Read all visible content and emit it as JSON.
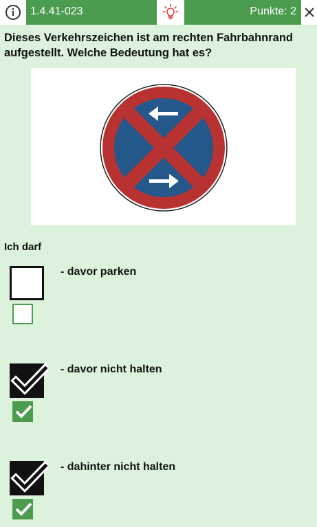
{
  "header": {
    "question_code": "1.4.41-023",
    "score_label": "Punkte: 2",
    "info_icon": "info-icon",
    "hint_icon": "lightbulb-icon",
    "close_icon": "close-icon"
  },
  "question": {
    "text": "Dieses Verkehrszeichen ist am rechten Fahrbahnrand aufgestellt. Welche Bedeutung hat es?",
    "sign": "absolute-halt-prohibition-sign"
  },
  "prompt": "Ich darf",
  "answers": [
    {
      "text": "- davor parken",
      "user_checked": false,
      "correct_checked": false
    },
    {
      "text": "- davor nicht halten",
      "user_checked": true,
      "correct_checked": true
    },
    {
      "text": "- dahinter nicht halten",
      "user_checked": true,
      "correct_checked": true
    }
  ],
  "colors": {
    "background": "#dcf2dc",
    "bar_green": "#4c9c50",
    "sign_red": "#b83232",
    "sign_blue": "#24578a"
  }
}
